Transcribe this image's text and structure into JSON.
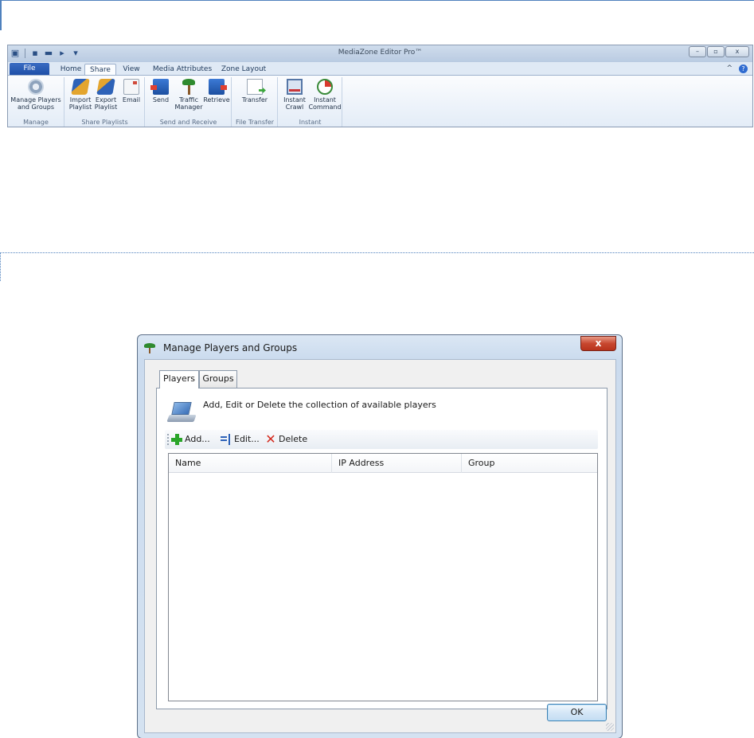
{
  "ribbon": {
    "app_title": "MediaZone Editor Pro™",
    "file_tab": "File",
    "tabs": [
      {
        "label": "Home"
      },
      {
        "label": "Share"
      },
      {
        "label": "View"
      },
      {
        "label": "Media Attributes"
      },
      {
        "label": "Zone Layout"
      }
    ],
    "active_tab": "Share",
    "groups": [
      {
        "label": "Manage",
        "buttons": [
          {
            "line1": "Manage Players",
            "line2": "and Groups",
            "icon": "gear-icon"
          }
        ]
      },
      {
        "label": "Share Playlists",
        "buttons": [
          {
            "line1": "Import",
            "line2": "Playlist",
            "icon": "import-icon"
          },
          {
            "line1": "Export",
            "line2": "Playlist",
            "icon": "export-icon"
          },
          {
            "line1": "Email",
            "line2": "",
            "icon": "email-icon"
          }
        ]
      },
      {
        "label": "Send and Receive",
        "buttons": [
          {
            "line1": "Send",
            "line2": "",
            "icon": "send-icon"
          },
          {
            "line1": "Traffic",
            "line2": "Manager",
            "icon": "palm-tree-icon"
          },
          {
            "line1": "Retrieve",
            "line2": "",
            "icon": "retrieve-icon"
          }
        ]
      },
      {
        "label": "File Transfer",
        "buttons": [
          {
            "line1": "Transfer",
            "line2": "",
            "icon": "transfer-icon"
          }
        ]
      },
      {
        "label": "Instant",
        "buttons": [
          {
            "line1": "Instant",
            "line2": "Crawl",
            "icon": "crawl-icon"
          },
          {
            "line1": "Instant",
            "line2": "Command",
            "icon": "stopwatch-icon"
          }
        ]
      }
    ]
  },
  "dialog": {
    "title": "Manage Players and Groups",
    "close_label": "x",
    "tabs": [
      {
        "label": "Players"
      },
      {
        "label": "Groups"
      }
    ],
    "description": "Add, Edit or Delete the collection of available players",
    "toolbar": {
      "add": "Add...",
      "edit": "Edit...",
      "delete": "Delete"
    },
    "columns": [
      {
        "label": "Name"
      },
      {
        "label": "IP Address"
      },
      {
        "label": "Group"
      }
    ],
    "rows": [],
    "ok_label": "OK"
  },
  "colors": {
    "accent": "#1f4fa8",
    "close": "#c8472f",
    "add": "#2aa52a",
    "delete": "#d42a1e"
  }
}
